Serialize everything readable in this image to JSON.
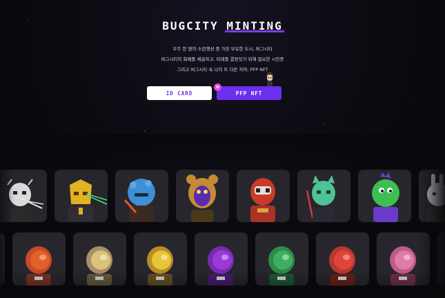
{
  "hero": {
    "title_part1": "BUGCITY",
    "title_part2": "MINTING",
    "desc_line1": "우주 한 편의 소란행성 중 가장 부유한 도시, 버그시티",
    "desc_line2": "버그시티의 화폐를 채굴하고, 미래를 결정짓기 위해 필요한 시민증",
    "desc_line3": "그리고 버그시티 속 나의 또 다른 자아, PFP NFT"
  },
  "buttons": {
    "id_card": "ID CARD",
    "pfp_nft": "PFP NFT",
    "badge": "N"
  },
  "colors": {
    "accent": "#6b2ff0",
    "underline": "#7b3ff2",
    "badge": "#e34bd6",
    "card_bg": "#26262c",
    "page_bg": "#08080c"
  },
  "row1_cards": [
    {
      "name": "skull-character",
      "bg": "#d9d9d9",
      "accent": "#555555"
    },
    {
      "name": "yellow-robot-laser",
      "bg": "#e0b323",
      "accent": "#4fe07a"
    },
    {
      "name": "blue-fuzzy-character",
      "bg": "#3d8fd6",
      "accent": "#e05a2a"
    },
    {
      "name": "bear-hood-purple-face",
      "bg": "#c58a35",
      "accent": "#5b2ab0"
    },
    {
      "name": "red-helmet-character",
      "bg": "#c93a2a",
      "accent": "#e8e0d0"
    },
    {
      "name": "green-cat-lightsaber",
      "bg": "#4fc296",
      "accent": "#d33a3a"
    },
    {
      "name": "green-dino-character",
      "bg": "#3fbf52",
      "accent": "#6a3ac8"
    },
    {
      "name": "white-rabbit-character",
      "bg": "#cfcfd4",
      "accent": "#333333"
    }
  ],
  "row2_cards": [
    {
      "name": "astronaut-orange",
      "visor": "#e2602c",
      "suit": "#c9482a"
    },
    {
      "name": "astronaut-tan",
      "visor": "#d9c47a",
      "suit": "#a8906a"
    },
    {
      "name": "astronaut-yellow",
      "visor": "#e8c43a",
      "suit": "#b98c2a"
    },
    {
      "name": "astronaut-purple",
      "visor": "#9a3ad6",
      "suit": "#7a2ab0"
    },
    {
      "name": "astronaut-green",
      "visor": "#3fae62",
      "suit": "#2e8a4a"
    },
    {
      "name": "astronaut-red",
      "visor": "#e0443a",
      "suit": "#b53a2e"
    },
    {
      "name": "astronaut-pink",
      "visor": "#e07aa8",
      "suit": "#c05a86"
    }
  ]
}
